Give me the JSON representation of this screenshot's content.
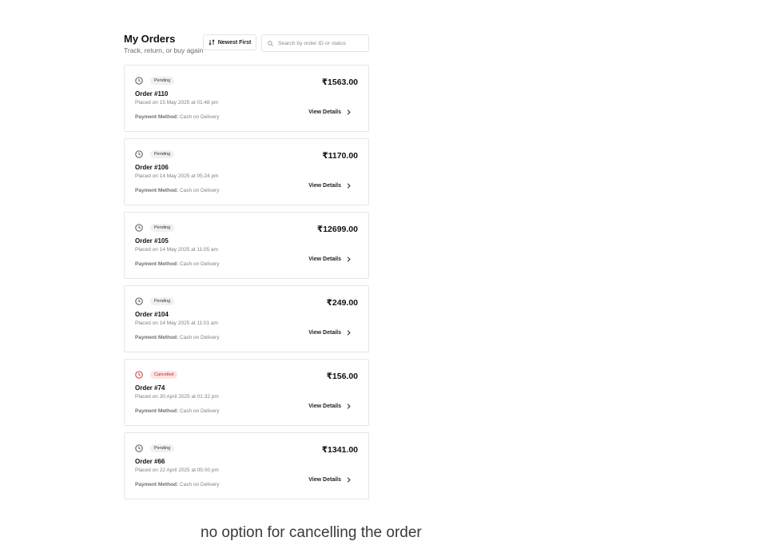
{
  "header": {
    "title": "My Orders",
    "subtitle": "Track, return, or buy again",
    "sort_label": "Newest First",
    "search_placeholder": "Search by order ID or status"
  },
  "orders": [
    {
      "status": "Pending",
      "id": "Order #110",
      "placed": "Placed on 15 May 2025 at 01:48 pm",
      "payment_label": "Payment Method:",
      "payment_value": " Cash on Delivery",
      "amount": "₹1563.00",
      "view": "View Details"
    },
    {
      "status": "Pending",
      "id": "Order #106",
      "placed": "Placed on 14 May 2025 at 05:24 pm",
      "payment_label": "Payment Method:",
      "payment_value": " Cash on Delivery",
      "amount": "₹1170.00",
      "view": "View Details"
    },
    {
      "status": "Pending",
      "id": "Order #105",
      "placed": "Placed on 14 May 2025 at 11:05 am",
      "payment_label": "Payment Method:",
      "payment_value": " Cash on Delivery",
      "amount": "₹12699.00",
      "view": "View Details"
    },
    {
      "status": "Pending",
      "id": "Order #104",
      "placed": "Placed on 14 May 2025 at 11:01 am",
      "payment_label": "Payment Method:",
      "payment_value": " Cash on Delivery",
      "amount": "₹249.00",
      "view": "View Details"
    },
    {
      "status": "Cancelled",
      "id": "Order #74",
      "placed": "Placed on 30 April 2025 at 01:32 pm",
      "payment_label": "Payment Method:",
      "payment_value": " Cash on Delivery",
      "amount": "₹156.00",
      "view": "View Details"
    },
    {
      "status": "Pending",
      "id": "Order #66",
      "placed": "Placed on 22 April 2025 at 05:00 pm",
      "payment_label": "Payment Method:",
      "payment_value": " Cash on Delivery",
      "amount": "₹1341.00",
      "view": "View Details"
    }
  ],
  "note": "no option for cancelling the order",
  "icons": {
    "status_pending": "clock-icon",
    "status_cancelled": "clock-icon",
    "sort": "sort-arrows-icon",
    "search": "search-icon",
    "view_details": "chevron-right-icon"
  },
  "colors": {
    "cancelled": "#c82323",
    "cancelled_badge_bg": "#fde4e4",
    "pending_badge_bg": "#f0f0f3"
  }
}
